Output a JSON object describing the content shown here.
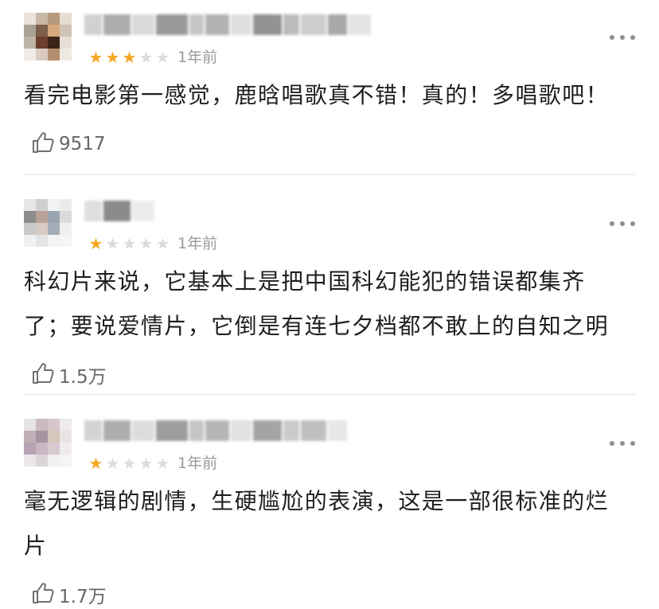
{
  "reviews": [
    {
      "rating": 3,
      "max_rating": 5,
      "time": "1年前",
      "content_lines": [
        "看完电影第一感觉，鹿晗唱歌真不错！真的！多唱歌吧！"
      ],
      "likes": "9517",
      "avatar_colors": [
        "#e9e3dc",
        "#c8b8a6",
        "#b59a7e",
        "#e5dcd2",
        "#a9a196",
        "#7d5e48",
        "#d7a97a",
        "#cfc3b5",
        "#bdb3a6",
        "#6a3f2c",
        "#3b2418",
        "#e7ded6",
        "#f0ebe6",
        "#d9cbbf",
        "#b48d6e",
        "#efe9e3"
      ],
      "name_blur_colors": [
        "#c9c9c9",
        "#9f9f9f",
        "#d4d4d4",
        "#888888",
        "#bdbdbd",
        "#a5a5a5",
        "#dadada",
        "#7f7f7f",
        "#b0b0b0",
        "#c5c5c5",
        "#999999",
        "#e0e0e0"
      ]
    },
    {
      "rating": 1,
      "max_rating": 5,
      "time": "1年前",
      "content_lines": [
        "科幻片来说，它基本上是把中国科幻能犯的错误都集齐",
        "了；要说爱情片，它倒是有连七夕档都不敢上的自知之明"
      ],
      "likes": "1.5万",
      "avatar_colors": [
        "#e6e6e6",
        "#cfcfcf",
        "#f2f2f2",
        "#ebebeb",
        "#8c8c8c",
        "#b9a397",
        "#9aa4b0",
        "#dadada",
        "#c9c9c9",
        "#d8cbc2",
        "#a3adb8",
        "#efefef",
        "#f0f0f0",
        "#e4e4e4",
        "#f3f3f3",
        "#f5f5f5"
      ],
      "name_blur_colors": [
        "#d9d9d9",
        "#777777",
        "#e8e8e8"
      ]
    },
    {
      "rating": 1,
      "max_rating": 5,
      "time": "1年前",
      "content_lines": [
        "毫无逻辑的剧情，生硬尴尬的表演，这是一部很标准的烂",
        "片"
      ],
      "likes": "1.7万",
      "avatar_colors": [
        "#e7e3e5",
        "#cbb9c1",
        "#d8c6ca",
        "#efebec",
        "#c1aeb6",
        "#a6949e",
        "#d5c7b9",
        "#e8e4e6",
        "#b6a4b4",
        "#c9b8c3",
        "#d7cad0",
        "#f0eced",
        "#ece8ea",
        "#dcd6da",
        "#f2eff0",
        "#f5f3f4"
      ],
      "name_blur_colors": [
        "#cccccc",
        "#a0a0a0",
        "#d7d7d7",
        "#8d8d8d",
        "#bcbcbc",
        "#a9a9a9",
        "#dcdcdc",
        "#959595",
        "#c2c2c2",
        "#b4b4b4",
        "#e3e3e3"
      ]
    }
  ]
}
